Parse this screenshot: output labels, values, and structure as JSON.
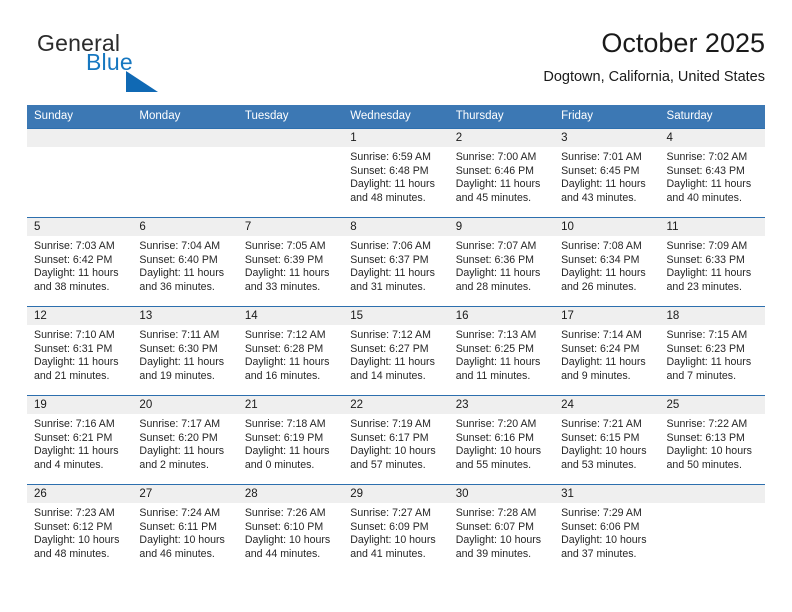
{
  "brand": {
    "name_part1": "General",
    "name_part2": "Blue",
    "logo_icon": "triangle-logo-icon",
    "colors": {
      "accent": "#1069b4",
      "text": "#2b2b2b"
    }
  },
  "header": {
    "title": "October 2025",
    "subtitle": "Dogtown, California, United States"
  },
  "calendar": {
    "header_bg": "#3c78b4",
    "row_divider": "#2d6fae",
    "daynum_bg": "#efefef",
    "weekday_headers": [
      "Sunday",
      "Monday",
      "Tuesday",
      "Wednesday",
      "Thursday",
      "Friday",
      "Saturday"
    ],
    "weeks": [
      [
        {
          "day": "",
          "lines": []
        },
        {
          "day": "",
          "lines": []
        },
        {
          "day": "",
          "lines": []
        },
        {
          "day": "1",
          "lines": [
            "Sunrise: 6:59 AM",
            "Sunset: 6:48 PM",
            "Daylight: 11 hours and 48 minutes."
          ]
        },
        {
          "day": "2",
          "lines": [
            "Sunrise: 7:00 AM",
            "Sunset: 6:46 PM",
            "Daylight: 11 hours and 45 minutes."
          ]
        },
        {
          "day": "3",
          "lines": [
            "Sunrise: 7:01 AM",
            "Sunset: 6:45 PM",
            "Daylight: 11 hours and 43 minutes."
          ]
        },
        {
          "day": "4",
          "lines": [
            "Sunrise: 7:02 AM",
            "Sunset: 6:43 PM",
            "Daylight: 11 hours and 40 minutes."
          ]
        }
      ],
      [
        {
          "day": "5",
          "lines": [
            "Sunrise: 7:03 AM",
            "Sunset: 6:42 PM",
            "Daylight: 11 hours and 38 minutes."
          ]
        },
        {
          "day": "6",
          "lines": [
            "Sunrise: 7:04 AM",
            "Sunset: 6:40 PM",
            "Daylight: 11 hours and 36 minutes."
          ]
        },
        {
          "day": "7",
          "lines": [
            "Sunrise: 7:05 AM",
            "Sunset: 6:39 PM",
            "Daylight: 11 hours and 33 minutes."
          ]
        },
        {
          "day": "8",
          "lines": [
            "Sunrise: 7:06 AM",
            "Sunset: 6:37 PM",
            "Daylight: 11 hours and 31 minutes."
          ]
        },
        {
          "day": "9",
          "lines": [
            "Sunrise: 7:07 AM",
            "Sunset: 6:36 PM",
            "Daylight: 11 hours and 28 minutes."
          ]
        },
        {
          "day": "10",
          "lines": [
            "Sunrise: 7:08 AM",
            "Sunset: 6:34 PM",
            "Daylight: 11 hours and 26 minutes."
          ]
        },
        {
          "day": "11",
          "lines": [
            "Sunrise: 7:09 AM",
            "Sunset: 6:33 PM",
            "Daylight: 11 hours and 23 minutes."
          ]
        }
      ],
      [
        {
          "day": "12",
          "lines": [
            "Sunrise: 7:10 AM",
            "Sunset: 6:31 PM",
            "Daylight: 11 hours and 21 minutes."
          ]
        },
        {
          "day": "13",
          "lines": [
            "Sunrise: 7:11 AM",
            "Sunset: 6:30 PM",
            "Daylight: 11 hours and 19 minutes."
          ]
        },
        {
          "day": "14",
          "lines": [
            "Sunrise: 7:12 AM",
            "Sunset: 6:28 PM",
            "Daylight: 11 hours and 16 minutes."
          ]
        },
        {
          "day": "15",
          "lines": [
            "Sunrise: 7:12 AM",
            "Sunset: 6:27 PM",
            "Daylight: 11 hours and 14 minutes."
          ]
        },
        {
          "day": "16",
          "lines": [
            "Sunrise: 7:13 AM",
            "Sunset: 6:25 PM",
            "Daylight: 11 hours and 11 minutes."
          ]
        },
        {
          "day": "17",
          "lines": [
            "Sunrise: 7:14 AM",
            "Sunset: 6:24 PM",
            "Daylight: 11 hours and 9 minutes."
          ]
        },
        {
          "day": "18",
          "lines": [
            "Sunrise: 7:15 AM",
            "Sunset: 6:23 PM",
            "Daylight: 11 hours and 7 minutes."
          ]
        }
      ],
      [
        {
          "day": "19",
          "lines": [
            "Sunrise: 7:16 AM",
            "Sunset: 6:21 PM",
            "Daylight: 11 hours and 4 minutes."
          ]
        },
        {
          "day": "20",
          "lines": [
            "Sunrise: 7:17 AM",
            "Sunset: 6:20 PM",
            "Daylight: 11 hours and 2 minutes."
          ]
        },
        {
          "day": "21",
          "lines": [
            "Sunrise: 7:18 AM",
            "Sunset: 6:19 PM",
            "Daylight: 11 hours and 0 minutes."
          ]
        },
        {
          "day": "22",
          "lines": [
            "Sunrise: 7:19 AM",
            "Sunset: 6:17 PM",
            "Daylight: 10 hours and 57 minutes."
          ]
        },
        {
          "day": "23",
          "lines": [
            "Sunrise: 7:20 AM",
            "Sunset: 6:16 PM",
            "Daylight: 10 hours and 55 minutes."
          ]
        },
        {
          "day": "24",
          "lines": [
            "Sunrise: 7:21 AM",
            "Sunset: 6:15 PM",
            "Daylight: 10 hours and 53 minutes."
          ]
        },
        {
          "day": "25",
          "lines": [
            "Sunrise: 7:22 AM",
            "Sunset: 6:13 PM",
            "Daylight: 10 hours and 50 minutes."
          ]
        }
      ],
      [
        {
          "day": "26",
          "lines": [
            "Sunrise: 7:23 AM",
            "Sunset: 6:12 PM",
            "Daylight: 10 hours and 48 minutes."
          ]
        },
        {
          "day": "27",
          "lines": [
            "Sunrise: 7:24 AM",
            "Sunset: 6:11 PM",
            "Daylight: 10 hours and 46 minutes."
          ]
        },
        {
          "day": "28",
          "lines": [
            "Sunrise: 7:26 AM",
            "Sunset: 6:10 PM",
            "Daylight: 10 hours and 44 minutes."
          ]
        },
        {
          "day": "29",
          "lines": [
            "Sunrise: 7:27 AM",
            "Sunset: 6:09 PM",
            "Daylight: 10 hours and 41 minutes."
          ]
        },
        {
          "day": "30",
          "lines": [
            "Sunrise: 7:28 AM",
            "Sunset: 6:07 PM",
            "Daylight: 10 hours and 39 minutes."
          ]
        },
        {
          "day": "31",
          "lines": [
            "Sunrise: 7:29 AM",
            "Sunset: 6:06 PM",
            "Daylight: 10 hours and 37 minutes."
          ]
        },
        {
          "day": "",
          "lines": []
        }
      ]
    ]
  }
}
